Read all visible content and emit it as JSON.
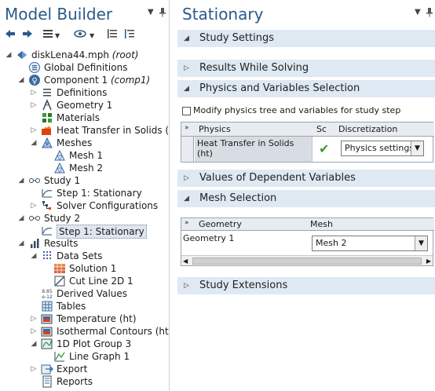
{
  "left_panel": {
    "title": "Model Builder",
    "tree": [
      {
        "label": "diskLena44.mph",
        "tag": "(root)",
        "icon": "model-file-icon",
        "expander": "expanded",
        "level": 0
      },
      {
        "label": "Global Definitions",
        "icon": "global-definitions-icon",
        "expander": "none",
        "level": 1
      },
      {
        "label": "Component 1",
        "tag": "(comp1)",
        "icon": "component-icon",
        "expander": "expanded",
        "level": 1
      },
      {
        "label": "Definitions",
        "icon": "definitions-icon",
        "expander": "collapsed",
        "level": 2
      },
      {
        "label": "Geometry 1",
        "icon": "geometry-icon",
        "expander": "collapsed",
        "level": 2
      },
      {
        "label": "Materials",
        "icon": "materials-icon",
        "expander": "none",
        "level": 2
      },
      {
        "label": "Heat Transfer in Solids (",
        "icon": "heat-transfer-icon",
        "expander": "collapsed",
        "level": 2
      },
      {
        "label": "Meshes",
        "icon": "meshes-icon",
        "expander": "expanded",
        "level": 2
      },
      {
        "label": "Mesh 1",
        "icon": "mesh-icon",
        "expander": "none",
        "level": 3
      },
      {
        "label": "Mesh 2",
        "icon": "mesh-icon",
        "expander": "none",
        "level": 3
      },
      {
        "label": "Study 1",
        "icon": "study-icon",
        "expander": "expanded",
        "level": 1
      },
      {
        "label": "Step 1: Stationary",
        "icon": "stationary-step-icon",
        "expander": "none",
        "level": 2
      },
      {
        "label": "Solver Configurations",
        "icon": "solver-configurations-icon",
        "expander": "collapsed",
        "level": 2
      },
      {
        "label": "Study 2",
        "icon": "study-icon",
        "expander": "expanded",
        "level": 1
      },
      {
        "label": "Step 1: Stationary",
        "icon": "stationary-step-icon",
        "expander": "none",
        "level": 2,
        "selected": true
      },
      {
        "label": "Results",
        "icon": "results-icon",
        "expander": "expanded",
        "level": 1
      },
      {
        "label": "Data Sets",
        "icon": "data-sets-icon",
        "expander": "expanded",
        "level": 2
      },
      {
        "label": "Solution 1",
        "icon": "solution-icon",
        "expander": "none",
        "level": 3
      },
      {
        "label": "Cut Line 2D 1",
        "icon": "cut-line-icon",
        "expander": "none",
        "level": 3
      },
      {
        "label": "Derived Values",
        "icon": "derived-values-icon",
        "expander": "none",
        "level": 2
      },
      {
        "label": "Tables",
        "icon": "tables-icon",
        "expander": "none",
        "level": 2
      },
      {
        "label": "Temperature (ht)",
        "icon": "plot-group-3d-icon",
        "expander": "collapsed",
        "level": 2
      },
      {
        "label": "Isothermal Contours (ht",
        "icon": "plot-group-3d-icon",
        "expander": "collapsed",
        "level": 2
      },
      {
        "label": "1D Plot Group 3",
        "icon": "plot-group-1d-icon",
        "expander": "expanded",
        "level": 2
      },
      {
        "label": "Line Graph 1",
        "icon": "line-graph-icon",
        "expander": "none",
        "level": 3
      },
      {
        "label": "Export",
        "icon": "export-icon",
        "expander": "collapsed",
        "level": 2
      },
      {
        "label": "Reports",
        "icon": "reports-icon",
        "expander": "none",
        "level": 2
      }
    ]
  },
  "right_panel": {
    "title": "Stationary",
    "sections": {
      "study_settings": "Study Settings",
      "results_while_solving": "Results While Solving",
      "physics_and_variables": "Physics and Variables Selection",
      "values_dependent": "Values of Dependent Variables",
      "mesh_selection": "Mesh Selection",
      "study_extensions": "Study Extensions"
    },
    "modify_checkbox_label": "Modify physics tree and variables for study step",
    "physics_table": {
      "headers": [
        "Physics",
        "Sc",
        "Discretization"
      ],
      "rows": [
        {
          "physics": "Heat Transfer in Solids (ht)",
          "solve": "✔",
          "discretization": "Physics settings"
        }
      ]
    },
    "mesh_table": {
      "headers": [
        "Geometry",
        "Mesh"
      ],
      "rows": [
        {
          "geometry": "Geometry 1",
          "mesh": "Mesh 2"
        }
      ]
    }
  },
  "colors": {
    "title_blue": "#2a5a8a",
    "section_header_bg": "#dfe9f3",
    "check_green": "#3a9a2a"
  }
}
